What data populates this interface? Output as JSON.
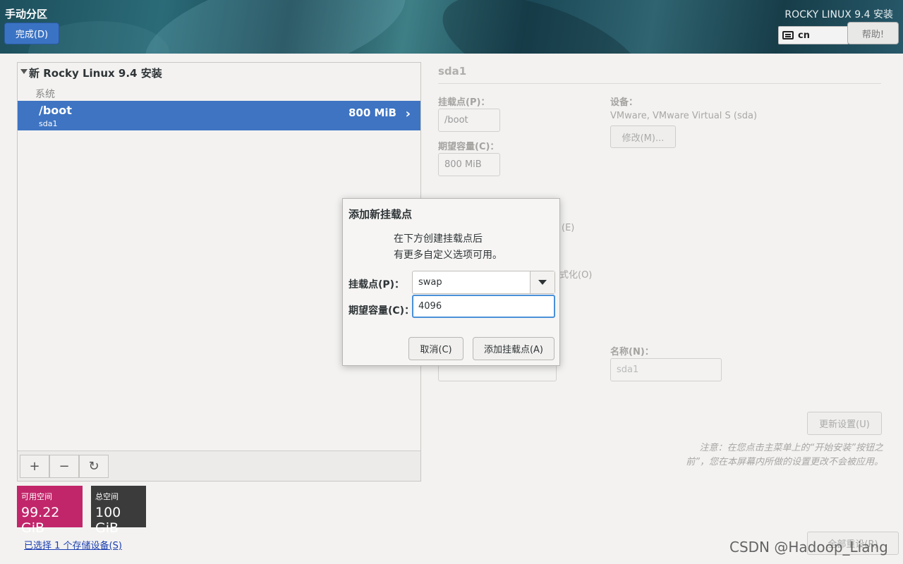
{
  "header": {
    "page_title": "手动分区",
    "done_label": "完成(D)",
    "product": "ROCKY LINUX 9.4 安装",
    "keyboard_layout": "cn",
    "help_label": "帮助!"
  },
  "left": {
    "install_title": "新 Rocky Linux 9.4 安装",
    "system_label": "系统",
    "partitions": [
      {
        "mount": "/boot",
        "device": "sda1",
        "size": "800 MiB"
      }
    ],
    "toolbar": {
      "add": "+",
      "remove": "−",
      "refresh": "↻"
    },
    "available_label": "可用空间",
    "available_value": "99.22 GiB",
    "total_label": "总空间",
    "total_value": "100 GiB",
    "storage_link": "已选择 1 个存储设备(S)"
  },
  "right": {
    "title": "sda1",
    "mount_label": "挂载点(P)：",
    "mount_value": "/boot",
    "capacity_label": "期望容量(C)：",
    "capacity_value": "800 MiB",
    "device_label": "设备：",
    "device_value": "VMware, VMware Virtual S (sda)",
    "modify_label": "修改(M)...",
    "partial_e": "(E)",
    "partial_format": "式化(O)",
    "name_label": "名称(N)：",
    "name_value": "sda1",
    "update_label": "更新设置(U)",
    "note": "注意：在您点击主菜单上的“开始安装”按钮之前”，您在本屏幕内所做的设置更改不会被应用。",
    "reset_label": "全部重设(R)"
  },
  "dialog": {
    "title": "添加新挂载点",
    "info_line1": "在下方创建挂载点后",
    "info_line2": "有更多自定义选项可用。",
    "mount_label": "挂载点(P)：",
    "mount_value": "swap",
    "capacity_label": "期望容量(C)：",
    "capacity_value": "4096",
    "cancel_label": "取消(C)",
    "add_label": "添加挂载点(A)"
  },
  "watermark": "CSDN @Hadoop_Liang"
}
